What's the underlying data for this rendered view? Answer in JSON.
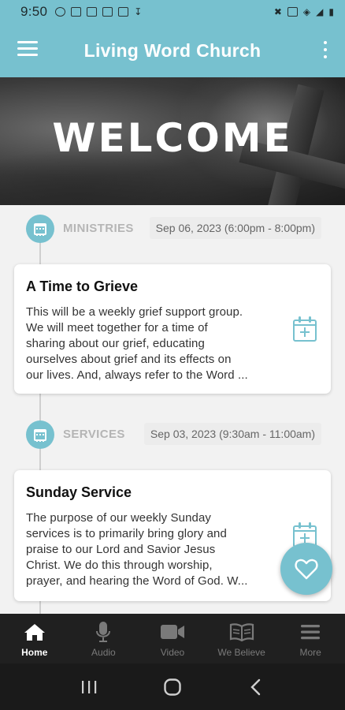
{
  "status_bar": {
    "time": "9:50"
  },
  "app_bar": {
    "title": "Living Word Church"
  },
  "hero": {
    "title": "WELCOME"
  },
  "events": [
    {
      "category": "MINISTRIES",
      "date": "Sep 06, 2023 (6:00pm - 8:00pm)",
      "title": "A Time to Grieve",
      "description_lines": [
        "This will be a weekly grief support group.",
        "We will meet together for a time of",
        "sharing about our grief, educating",
        "ourselves about grief and its effects on",
        "our lives. And, always refer to the Word ..."
      ]
    },
    {
      "category": "SERVICES",
      "date": "Sep 03, 2023 (9:30am - 11:00am)",
      "title": "Sunday Service",
      "description_lines": [
        "The purpose of our weekly Sunday",
        "services is to primarily bring glory and",
        "praise to our Lord and Savior Jesus",
        "Christ. We do this through worship,",
        "prayer, and hearing the Word of God. W..."
      ]
    }
  ],
  "bottom_nav": [
    {
      "label": "Home",
      "icon": "home-icon",
      "active": true
    },
    {
      "label": "Audio",
      "icon": "microphone-icon",
      "active": false
    },
    {
      "label": "Video",
      "icon": "video-camera-icon",
      "active": false
    },
    {
      "label": "We Believe",
      "icon": "book-icon",
      "active": false
    },
    {
      "label": "More",
      "icon": "menu-icon",
      "active": false
    }
  ],
  "colors": {
    "accent": "#77c1cf",
    "nav_bg": "#202020",
    "background": "#f2f2f2"
  }
}
